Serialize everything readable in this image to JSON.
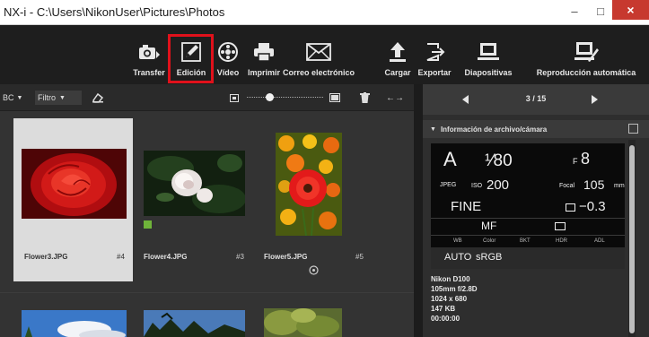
{
  "window": {
    "title": "NX-i - C:\\Users\\NikonUser\\Pictures\\Photos",
    "minimize_label": "–",
    "maximize_label": "□",
    "close_label": "×"
  },
  "toolbar": {
    "items": [
      {
        "label": "Transfer",
        "icon": "camera-transfer-icon"
      },
      {
        "label": "Edición",
        "icon": "edit-pencil-icon"
      },
      {
        "label": "Vídeo",
        "icon": "video-reel-icon"
      },
      {
        "label": "Imprimir",
        "icon": "printer-icon"
      },
      {
        "label": "Correo electrónico",
        "icon": "envelope-icon"
      },
      {
        "label": "Cargar",
        "icon": "upload-icon"
      },
      {
        "label": "Exportar",
        "icon": "export-icon"
      },
      {
        "label": "Diapositivas",
        "icon": "slideshow-icon"
      },
      {
        "label": "Reproducción automática",
        "icon": "autoplay-icon"
      }
    ],
    "highlight_color": "#e0111b"
  },
  "browser": {
    "sort_label": "BC",
    "filter_label": "Filtro"
  },
  "thumbnails": [
    {
      "filename": "Flower3.JPG",
      "number": "#4"
    },
    {
      "filename": "Flower4.JPG",
      "number": "#3"
    },
    {
      "filename": "Flower5.JPG",
      "number": "#5"
    }
  ],
  "viewer": {
    "counter": "3 / 15"
  },
  "info_panel": {
    "header": "Información de archivo/cámara",
    "mode": "A",
    "shutter": "¹⁄80",
    "aperture_prefix": "F",
    "aperture": "8",
    "format": "JPEG",
    "iso_label": "ISO",
    "iso": "200",
    "focal_label": "Focal",
    "focal": "105",
    "focal_unit": "mm",
    "quality": "FINE",
    "exposure_comp": "−0.3",
    "focus_mode": "MF",
    "wb_label": "WB",
    "color_label": "Color",
    "bkt_label": "BKT",
    "hdr_label": "HDR",
    "adl_label": "ADL",
    "wb_value": "AUTO",
    "color_value": "sRGB",
    "camera": "Nikon D100",
    "lens": "105mm f/2.8D",
    "dimensions": "1024 x 680",
    "filesize": "147 KB",
    "time": "00:00:00"
  },
  "colors": {
    "toolbar_bg": "#1e1e1e",
    "panel_bg": "#333333",
    "selected_thumb_bg": "#dcdcdc",
    "close_button": "#c7392f"
  }
}
